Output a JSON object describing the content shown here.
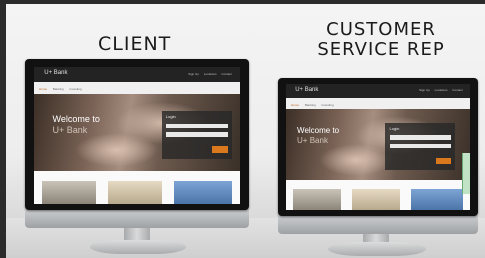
{
  "captions": {
    "client": "CLIENT",
    "rep_line1": "CUSTOMER",
    "rep_line2": "SERVICE REP"
  },
  "site": {
    "logo": "U+ Bank",
    "top_links": [
      "Sign Up",
      "Locations",
      "Contact"
    ],
    "nav": [
      "Home",
      "Banking",
      "Investing"
    ],
    "welcome_line1": "Welcome to",
    "welcome_line2": "U+ Bank",
    "login_title": "Login"
  },
  "colors": {
    "accent": "#d9781c",
    "dark": "#232323"
  }
}
